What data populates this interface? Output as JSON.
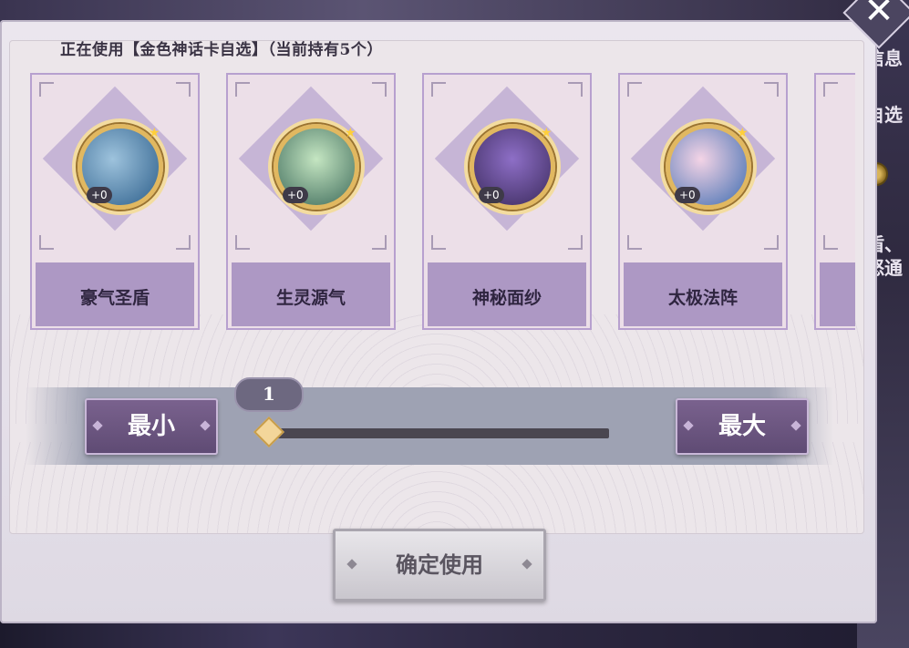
{
  "header": {
    "text": "正在使用【金色神话卡自选】（当前持有5个）"
  },
  "cards": [
    {
      "name": "豪气圣盾",
      "level": "+0",
      "colors": [
        "#2c5e8a",
        "#9ec3dd"
      ]
    },
    {
      "name": "生灵源气",
      "level": "+0",
      "colors": [
        "#3d6a5a",
        "#c5e6c2"
      ]
    },
    {
      "name": "神秘面纱",
      "level": "+0",
      "colors": [
        "#3b2a5c",
        "#8e6fc7"
      ]
    },
    {
      "name": "太极法阵",
      "level": "+0",
      "colors": [
        "#3d6cb0",
        "#f4d4e6"
      ]
    }
  ],
  "slider": {
    "min_label": "最小",
    "max_label": "最大",
    "value": "1",
    "position_fraction": 0.0
  },
  "confirm_label": "确定使用",
  "side": {
    "text1": "信息",
    "text2": "自选",
    "text3": "盾、",
    "text4": "怒通"
  },
  "colors": {
    "accent": "#ad98c4",
    "card_border": "#b7a0cf",
    "thumb": "#f3d69a"
  }
}
